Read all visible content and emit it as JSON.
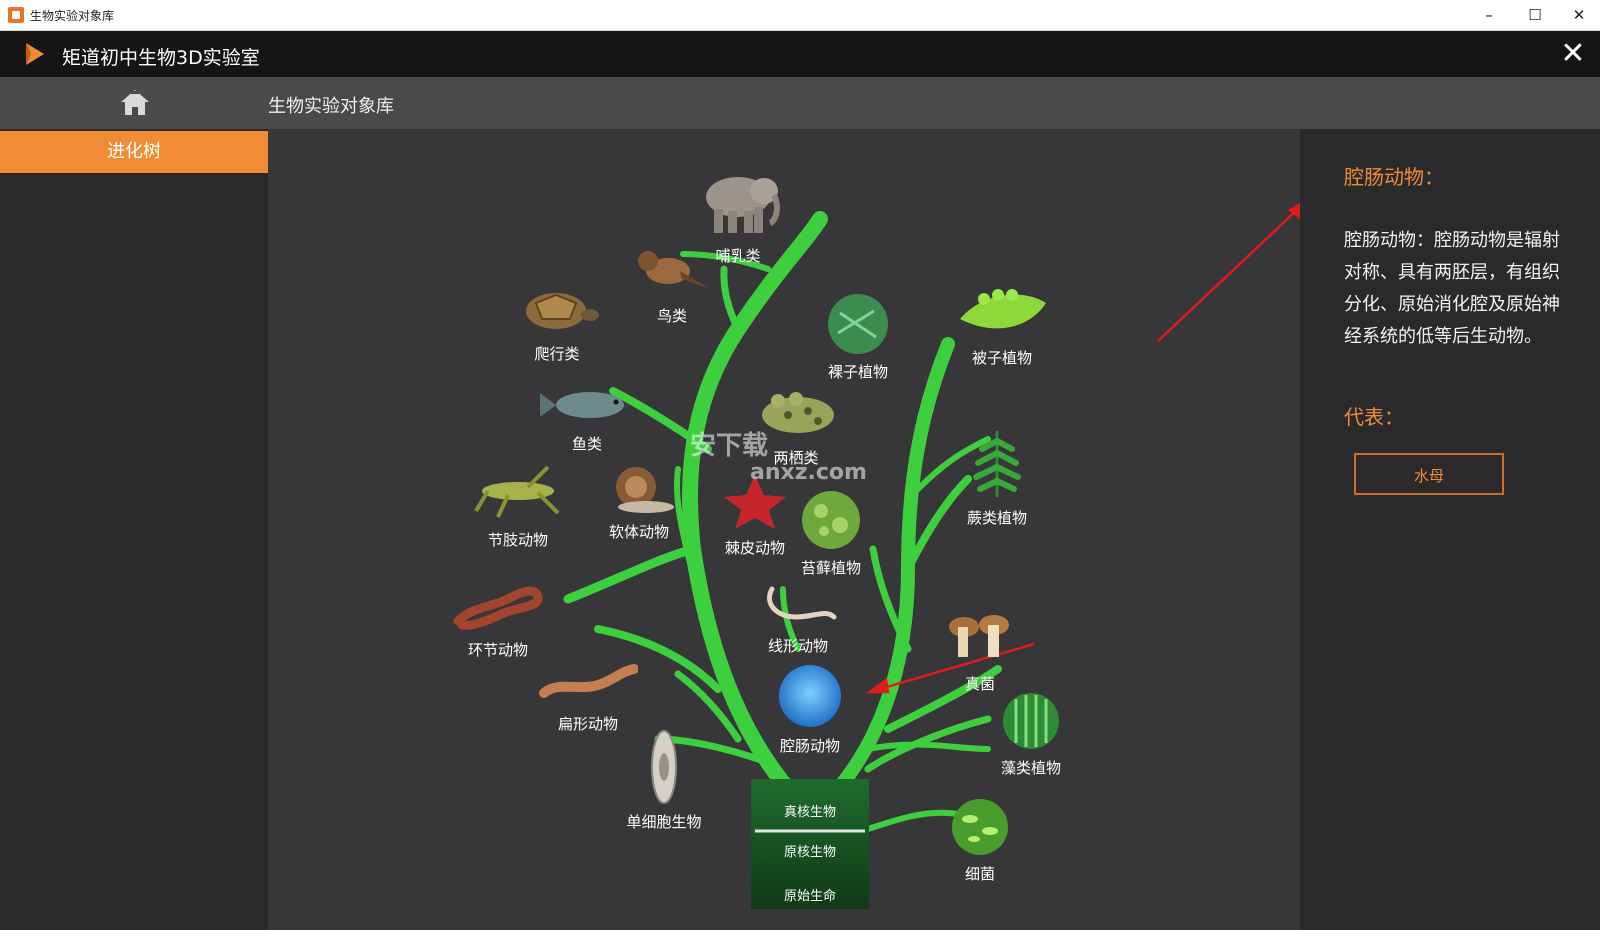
{
  "window": {
    "title": "生物实验对象库"
  },
  "app": {
    "title": "矩道初中生物3D实验室"
  },
  "nav": {
    "title": "生物实验对象库"
  },
  "sidebar": {
    "items": [
      {
        "label": "进化树",
        "active": true
      }
    ]
  },
  "tree": {
    "trunk_labels": [
      "真核生物",
      "原核生物",
      "原始生命"
    ],
    "organisms": [
      {
        "label": "哺乳类"
      },
      {
        "label": "鸟类"
      },
      {
        "label": "爬行类"
      },
      {
        "label": "鱼类"
      },
      {
        "label": "两栖类"
      },
      {
        "label": "节肢动物"
      },
      {
        "label": "软体动物"
      },
      {
        "label": "棘皮动物"
      },
      {
        "label": "环节动物"
      },
      {
        "label": "线形动物"
      },
      {
        "label": "扁形动物"
      },
      {
        "label": "腔肠动物"
      },
      {
        "label": "单细胞生物"
      },
      {
        "label": "裸子植物"
      },
      {
        "label": "被子植物"
      },
      {
        "label": "蕨类植物"
      },
      {
        "label": "苔藓植物"
      },
      {
        "label": "真菌"
      },
      {
        "label": "藻类植物"
      },
      {
        "label": "细菌"
      }
    ]
  },
  "info": {
    "heading": "腔肠动物：",
    "description": "腔肠动物：腔肠动物是辐射对称、具有两胚层，有组织分化、原始消化腔及原始神经系统的低等后生动物。",
    "rep_heading": "代表：",
    "rep_button": "水母"
  },
  "watermark": {
    "text": "安下载",
    "sub": "anxz.com"
  },
  "colors": {
    "accent": "#f08c33",
    "tree_green": "#3ecf3e",
    "arrow_red": "#e01b1b"
  }
}
